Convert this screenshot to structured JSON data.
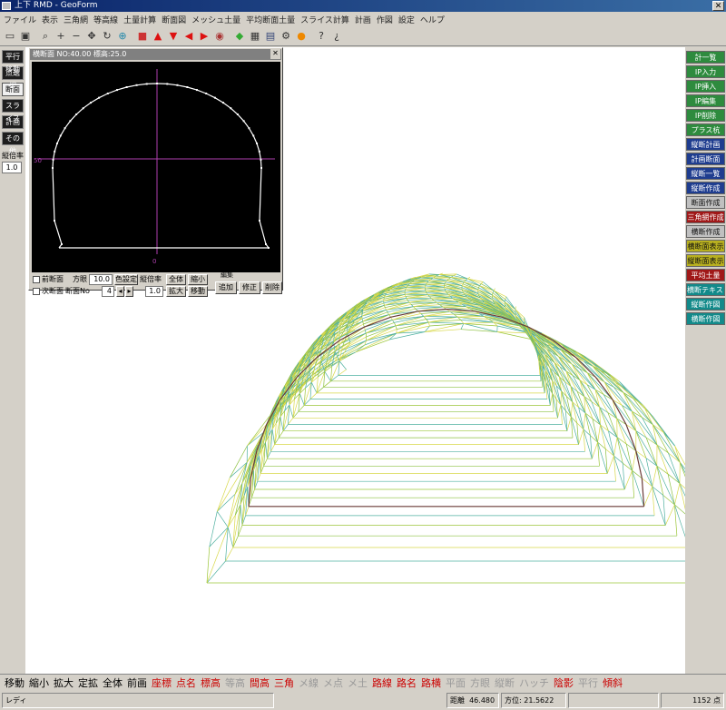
{
  "window": {
    "title": "上下 RMD - GeoForm"
  },
  "menu": [
    "ファイル",
    "表示",
    "三角網",
    "等高線",
    "土量計算",
    "断面図",
    "メッシュ土量",
    "平均断面土量",
    "スライス計算",
    "計画",
    "作図",
    "設定",
    "ヘルプ"
  ],
  "toolbar_icons": [
    "new-file-icon",
    "save-icon",
    "zoom-icon",
    "plus-icon",
    "minus-icon",
    "pan-icon",
    "rotate-icon",
    "zoom-window-icon",
    "cube-icon",
    "arrow-up-icon",
    "arrow-down-icon",
    "arrow-left-icon",
    "arrow-right-icon",
    "view-icon",
    "palette-icon",
    "grid-icon",
    "layers-icon",
    "settings-icon",
    "color-icon",
    "help-icon",
    "about-icon"
  ],
  "left_panel": {
    "buttons": [
      "平行移動",
      "点選択",
      "断面",
      "スライス",
      "計画",
      "その他"
    ],
    "active_index": 2,
    "scale_label": "縦倍率",
    "scale_value": "1.0"
  },
  "right_panel": {
    "buttons": [
      {
        "label": "計一覧",
        "color": "#2e8b3e"
      },
      {
        "label": "IP入力",
        "color": "#2e8b3e"
      },
      {
        "label": "IP挿入",
        "color": "#2e8b3e"
      },
      {
        "label": "IP編集",
        "color": "#2e8b3e"
      },
      {
        "label": "IP削除",
        "color": "#2e8b3e"
      },
      {
        "label": "プラス杭",
        "color": "#2e8b3e"
      },
      {
        "label": "縦断計画",
        "color": "#1f3d8f"
      },
      {
        "label": "計画断面",
        "color": "#1f3d8f"
      },
      {
        "label": "縦断一覧",
        "color": "#1f3d8f"
      },
      {
        "label": "縦断作成",
        "color": "#1f3d8f"
      },
      {
        "label": "断面作成",
        "color": "#c0c0c0"
      },
      {
        "label": "三角網作成",
        "color": "#a01818"
      },
      {
        "label": "横断作成",
        "color": "#c0c0c0"
      },
      {
        "label": "横断面表示",
        "color": "#b8b020"
      },
      {
        "label": "縦断面表示",
        "color": "#b8b020"
      },
      {
        "label": "平均土量",
        "color": "#a01818"
      },
      {
        "label": "横断テキスト",
        "color": "#128a8a"
      },
      {
        "label": "縦断作図",
        "color": "#128a8a"
      },
      {
        "label": "横断作図",
        "color": "#128a8a"
      }
    ]
  },
  "cross_section": {
    "title": "横断面 NO:40.00 標高:25.0",
    "axis_left_label": "50",
    "axis_bottom_label": "0",
    "controls": {
      "check1_label": "前断面",
      "pitch_label": "方眼",
      "pitch_value": "10.0",
      "color_button": "色設定",
      "vscale_label": "縦倍率",
      "full_button": "全体",
      "shrink_button": "縮小",
      "edit_group_label": "編集",
      "check2_label": "次断面",
      "section_no_label": "断面No",
      "section_no_value": "4",
      "vscale_value": "1.0",
      "zoom_button": "拡大",
      "move_button": "移動",
      "add_button": "追加",
      "modify_button": "修正",
      "delete_button": "削除"
    }
  },
  "bottom_toolbar": [
    {
      "label": "移動",
      "style": "normal"
    },
    {
      "label": "縮小",
      "style": "normal"
    },
    {
      "label": "拡大",
      "style": "normal"
    },
    {
      "label": "定拡",
      "style": "normal"
    },
    {
      "label": "全体",
      "style": "normal"
    },
    {
      "label": "前画",
      "style": "normal"
    },
    {
      "label": "座標",
      "style": "red"
    },
    {
      "label": "点名",
      "style": "red"
    },
    {
      "label": "標高",
      "style": "red"
    },
    {
      "label": "等高",
      "style": "grey"
    },
    {
      "label": "間高",
      "style": "red"
    },
    {
      "label": "三角",
      "style": "red"
    },
    {
      "label": "メ線",
      "style": "grey"
    },
    {
      "label": "メ点",
      "style": "grey"
    },
    {
      "label": "メ土",
      "style": "grey"
    },
    {
      "label": "路線",
      "style": "red"
    },
    {
      "label": "路名",
      "style": "red"
    },
    {
      "label": "路横",
      "style": "red"
    },
    {
      "label": "平面",
      "style": "grey"
    },
    {
      "label": "方眼",
      "style": "grey"
    },
    {
      "label": "縦断",
      "style": "grey"
    },
    {
      "label": "ハッチ",
      "style": "grey"
    },
    {
      "label": "陰影",
      "style": "red"
    },
    {
      "label": "平行",
      "style": "grey"
    },
    {
      "label": "傾斜",
      "style": "red"
    }
  ],
  "status": {
    "ready": "レディ",
    "distance_label": "距離",
    "distance_value": "46.480",
    "direction": "方位: 21.5622",
    "points": "1152 点"
  }
}
